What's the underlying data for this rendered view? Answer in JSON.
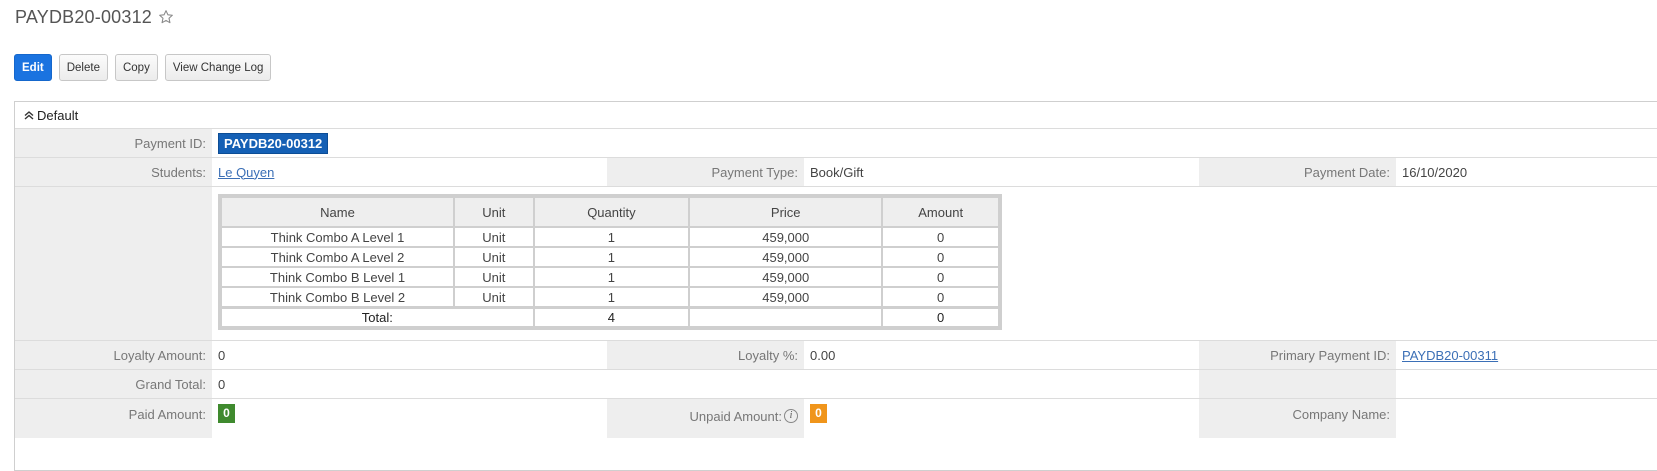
{
  "record": {
    "title": "PAYDB20-00312"
  },
  "toolbar": {
    "edit": "Edit",
    "delete": "Delete",
    "copy": "Copy",
    "changelog": "View Change Log"
  },
  "panel": {
    "title": "Default"
  },
  "fields": {
    "payment_id_label": "Payment ID:",
    "payment_id": "PAYDB20-00312",
    "students_label": "Students:",
    "students": "Le Quyen",
    "payment_type_label": "Payment Type:",
    "payment_type": "Book/Gift",
    "payment_date_label": "Payment Date:",
    "payment_date": "16/10/2020",
    "loyalty_amount_label": "Loyalty Amount:",
    "loyalty_amount": "0",
    "loyalty_pct_label": "Loyalty %:",
    "loyalty_pct": "0.00",
    "primary_payment_label": "Primary Payment ID:",
    "primary_payment": "PAYDB20-00311",
    "grand_total_label": "Grand Total:",
    "grand_total": "0",
    "paid_amount_label": "Paid Amount:",
    "paid_amount": "0",
    "unpaid_amount_label": "Unpaid Amount:",
    "unpaid_amount": "0",
    "company_name_label": "Company Name:"
  },
  "items": {
    "headers": {
      "name": "Name",
      "unit": "Unit",
      "quantity": "Quantity",
      "price": "Price",
      "amount": "Amount"
    },
    "rows": [
      {
        "name": "Think Combo A Level 1",
        "unit": "Unit",
        "quantity": "1",
        "price": "459,000",
        "amount": "0"
      },
      {
        "name": "Think Combo A Level 2",
        "unit": "Unit",
        "quantity": "1",
        "price": "459,000",
        "amount": "0"
      },
      {
        "name": "Think Combo B Level 1",
        "unit": "Unit",
        "quantity": "1",
        "price": "459,000",
        "amount": "0"
      },
      {
        "name": "Think Combo B Level 2",
        "unit": "Unit",
        "quantity": "1",
        "price": "459,000",
        "amount": "0"
      }
    ],
    "total_label": "Total:",
    "total_quantity": "4",
    "total_amount": "0"
  }
}
